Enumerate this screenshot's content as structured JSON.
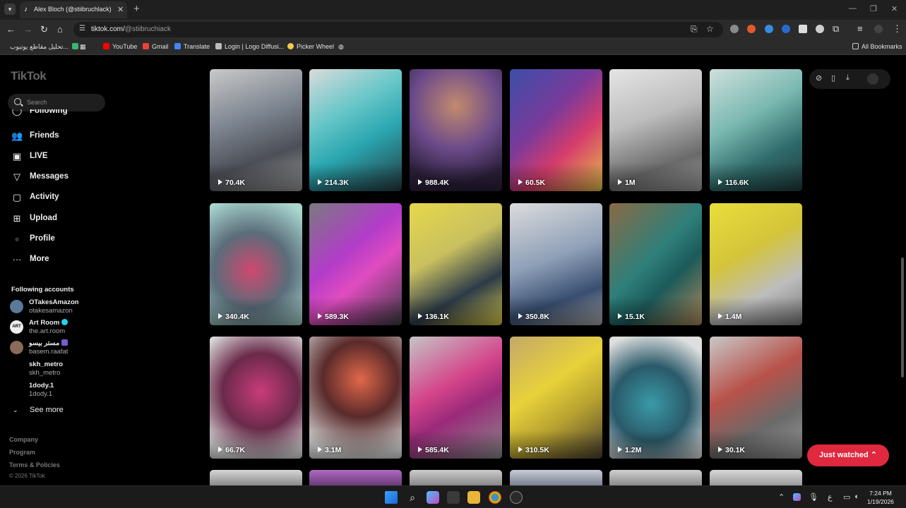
{
  "browser": {
    "tab_title": "Alex Bloch (@stiibruchlack) | Ti...",
    "url_host": "tiktok.com/",
    "url_path": "@stiibruchiack",
    "bookmarks": [
      {
        "label": "تحليل مقاطع يوتيوب...",
        "color": "#3cb371"
      },
      {
        "label": "",
        "color": "#888888"
      },
      {
        "label": "YouTube",
        "color": "#ff0000"
      },
      {
        "label": "Gmail",
        "color": "#ea4335"
      },
      {
        "label": "Translate",
        "color": "#4285f4"
      },
      {
        "label": "Login | Logo Diffusi...",
        "color": "#bbbbbb"
      },
      {
        "label": "Picker Wheel",
        "color": "#f2c94c"
      }
    ],
    "all_bookmarks": "All Bookmarks"
  },
  "sidebar": {
    "logo": "TikTok",
    "search_placeholder": "Search",
    "nav": [
      {
        "label": "Following",
        "icon": "following-icon"
      },
      {
        "label": "Friends",
        "icon": "friends-icon"
      },
      {
        "label": "LIVE",
        "icon": "live-icon"
      },
      {
        "label": "Messages",
        "icon": "messages-icon"
      },
      {
        "label": "Activity",
        "icon": "activity-icon"
      },
      {
        "label": "Upload",
        "icon": "upload-icon"
      },
      {
        "label": "Profile",
        "icon": "profile-icon"
      },
      {
        "label": "More",
        "icon": "more-icon"
      }
    ],
    "following_title": "Following accounts",
    "accounts": [
      {
        "name": "OTakesAmazon",
        "handle": "otakesamazon",
        "color": "#5a7a9a",
        "verified": false
      },
      {
        "name": "Art Room",
        "handle": "the.art.room",
        "color": "#eeeeee",
        "verified": true
      },
      {
        "name": "مستر بيسو",
        "handle": "basem.raafat",
        "color": "#8a6a5a",
        "verified": false
      },
      {
        "name": "skh_metro",
        "handle": "skh_metro",
        "color": "",
        "verified": false
      },
      {
        "name": "1dody.1",
        "handle": "1dody.1",
        "color": "",
        "verified": false
      }
    ],
    "see_more": "See more",
    "footer": [
      "Company",
      "Program",
      "Terms & Policies"
    ],
    "copyright": "© 2026 TikTok"
  },
  "videos": [
    {
      "views": "70.4K",
      "bg": "linear-gradient(160deg,#c9c9c9 0%,#7d8590 40%,#4c4f57 70%,#9a9a9a 100%)"
    },
    {
      "views": "214.3K",
      "bg": "linear-gradient(150deg,#d8dcdc 0%,#67c6c8 35%,#2aa6b0 60%,#243a40 100%)"
    },
    {
      "views": "988.4K",
      "bg": "radial-gradient(circle at 50% 30%,#c28a6e 0%,#6b4a8a 45%,#2b1f3a 80%)"
    },
    {
      "views": "60.5K",
      "bg": "linear-gradient(135deg,#3b4fa8 0%,#7a3a9a 40%,#d63d6b 65%,#e3c04a 100%)"
    },
    {
      "views": "1M",
      "bg": "linear-gradient(160deg,#e5e5e5 0%,#bdbdbd 40%,#6a6a6a 75%,#9e9e9e 100%)"
    },
    {
      "views": "116.6K",
      "bg": "linear-gradient(150deg,#cfe0dd 0%,#79b8b0 40%,#2f6a6a 70%,#1f3a3a 100%)"
    },
    {
      "views": "340.4K",
      "bg": "radial-gradient(circle at 45% 55%,#d0486f 0%,#5a6d7a 45%,#a9d6cf 90%)"
    },
    {
      "views": "589.3K",
      "bg": "linear-gradient(140deg,#7a7a80 0%,#b23cc9 40%,#e04cc0 60%,#3a3a3f 100%)"
    },
    {
      "views": "136.1K",
      "bg": "linear-gradient(150deg,#e6d84a 0%,#c9c060 40%,#2c3a48 70%,#d8c84a 100%)"
    },
    {
      "views": "350.8K",
      "bg": "linear-gradient(160deg,#dcdcdc 0%,#8fa0b8 45%,#394e70 75%,#a8a8a8 100%)"
    },
    {
      "views": "15.1K",
      "bg": "linear-gradient(135deg,#8a6a44 0%,#2e7f7a 45%,#1c5a5a 65%,#b08a5a 100%)"
    },
    {
      "views": "1.4M",
      "bg": "linear-gradient(150deg,#e8de3a 0%,#d4c43a 40%,#bdbdbd 70%,#7a7a7a 100%)"
    },
    {
      "views": "66.7K",
      "bg": "radial-gradient(circle at 55% 45%,#c93c7a 0%,#6a2a4a 45%,#dadada 85%)"
    },
    {
      "views": "3.1M",
      "bg": "radial-gradient(circle at 55% 35%,#e0684a 0%,#5a2a2a 40%,#d8d8d8 85%)"
    },
    {
      "views": "585.4K",
      "bg": "linear-gradient(150deg,#c4c4c4 0%,#d4448a 40%,#9a2a7a 60%,#8a8a8a 100%)"
    },
    {
      "views": "310.5K",
      "bg": "linear-gradient(145deg,#c4a86a 0%,#e8d23a 40%,#b8a230 65%,#4a4030 100%)"
    },
    {
      "views": "1.2M",
      "bg": "radial-gradient(circle at 45% 55%,#3a9aa8 0%,#2a5a6a 45%,#dedede 85%)"
    },
    {
      "views": "30.1K",
      "bg": "linear-gradient(150deg,#c8c8c8 0%,#b8524a 40%,#6a6a6a 70%,#9a9a9a 100%)"
    },
    {
      "views": "",
      "bg": "linear-gradient(180deg,#d6d6d6,#8a8a8a)"
    },
    {
      "views": "",
      "bg": "linear-gradient(180deg,#b06ac0,#6a3a7a)"
    },
    {
      "views": "",
      "bg": "linear-gradient(180deg,#cccccc,#888888)"
    },
    {
      "views": "",
      "bg": "linear-gradient(180deg,#c8ccd8,#7a8090)"
    },
    {
      "views": "",
      "bg": "linear-gradient(180deg,#d0d0d0,#8a8a8a)"
    },
    {
      "views": "",
      "bg": "linear-gradient(180deg,#d8d8d8,#9a9a9a)"
    }
  ],
  "just_watched": "Just watched",
  "taskbar": {
    "time": "7:24 PM",
    "date": "1/19/2026",
    "lang": "ع"
  }
}
